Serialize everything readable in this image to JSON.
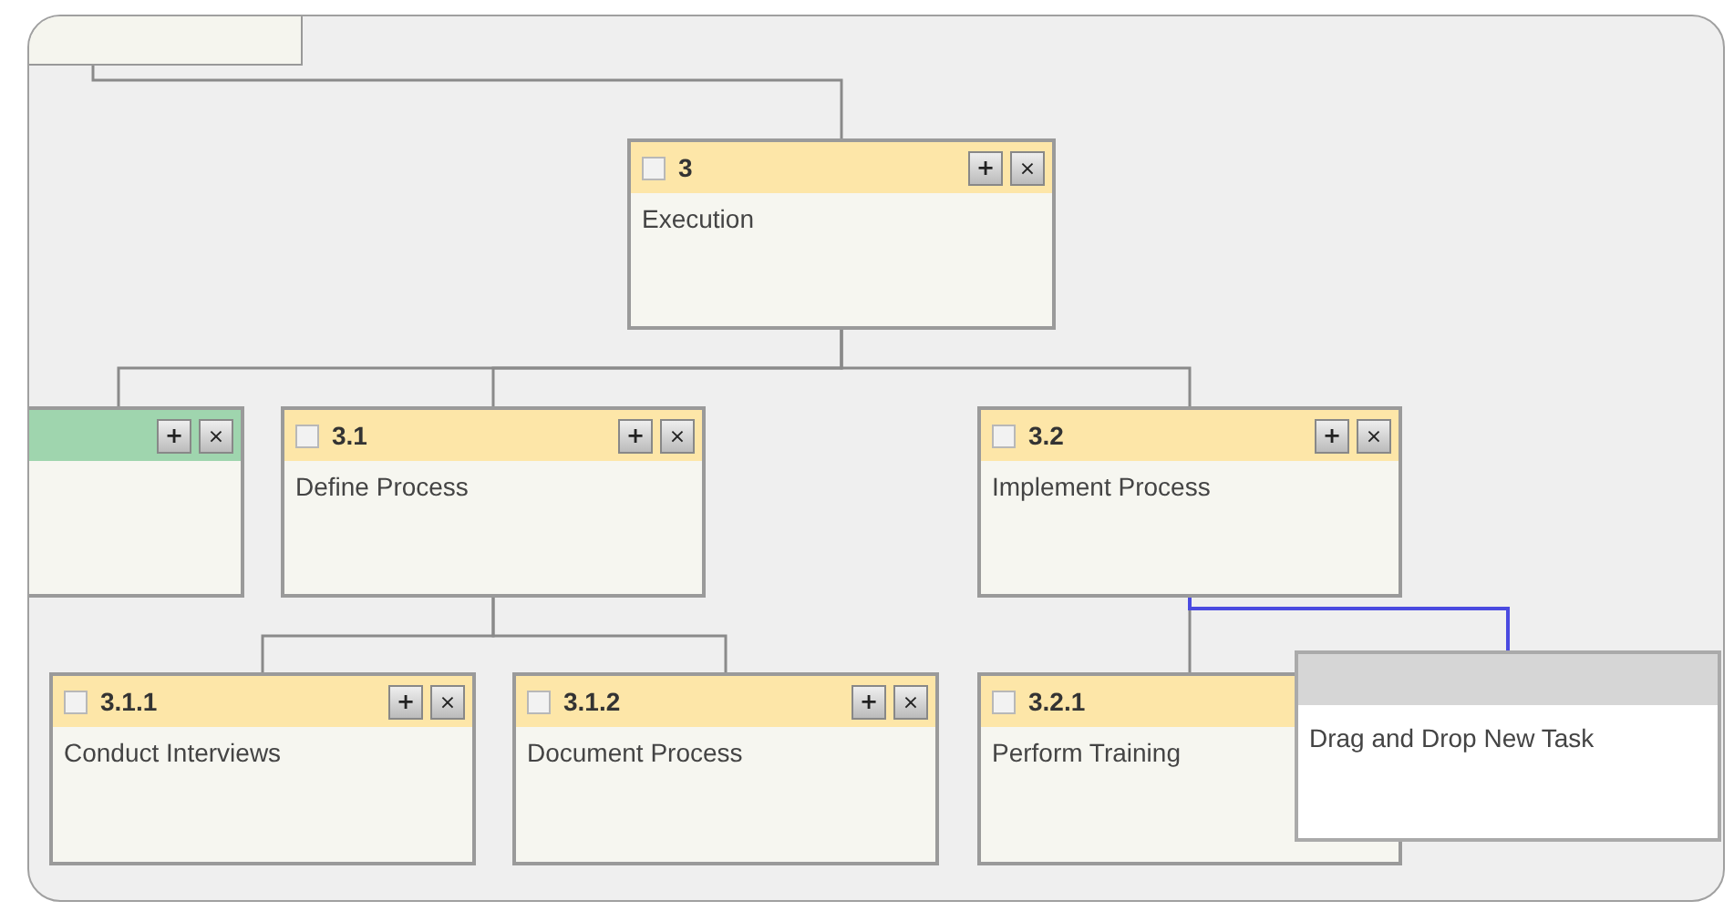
{
  "diagram": {
    "nodes": [
      {
        "kind": "fragment",
        "children": [
          {
            "kind": "task",
            "number": "3",
            "title": "Execution",
            "color": "#fde6a8",
            "checked": false,
            "buttons": [
              {
                "kind": "add",
                "label": "+"
              },
              {
                "kind": "delete",
                "label": "×"
              }
            ],
            "children": [
              {
                "kind": "task",
                "color": "#9fd5ae",
                "buttons": [
                  {
                    "kind": "add",
                    "label": "+"
                  },
                  {
                    "kind": "delete",
                    "label": "×"
                  }
                ]
              },
              {
                "kind": "task",
                "number": "3.1",
                "title": "Define Process",
                "color": "#fde6a8",
                "checked": false,
                "buttons": [
                  {
                    "kind": "add",
                    "label": "+"
                  },
                  {
                    "kind": "delete",
                    "label": "×"
                  }
                ],
                "children": [
                  {
                    "kind": "task",
                    "number": "3.1.1",
                    "title": "Conduct Interviews",
                    "color": "#fde6a8",
                    "checked": false,
                    "buttons": [
                      {
                        "kind": "add",
                        "label": "+"
                      },
                      {
                        "kind": "delete",
                        "label": "×"
                      }
                    ]
                  },
                  {
                    "kind": "task",
                    "number": "3.1.2",
                    "title": "Document Process",
                    "color": "#fde6a8",
                    "checked": false,
                    "buttons": [
                      {
                        "kind": "add",
                        "label": "+"
                      },
                      {
                        "kind": "delete",
                        "label": "×"
                      }
                    ]
                  }
                ]
              },
              {
                "kind": "task",
                "number": "3.2",
                "title": "Implement Process",
                "color": "#fde6a8",
                "checked": false,
                "buttons": [
                  {
                    "kind": "add",
                    "label": "+"
                  },
                  {
                    "kind": "delete",
                    "label": "×"
                  }
                ],
                "children": [
                  {
                    "kind": "task",
                    "number": "3.2.1",
                    "title": "Perform Training",
                    "color": "#fde6a8",
                    "checked": false
                  }
                ]
              }
            ]
          }
        ]
      }
    ],
    "drag_preview": {
      "label": "Drag and Drop New Task"
    }
  }
}
